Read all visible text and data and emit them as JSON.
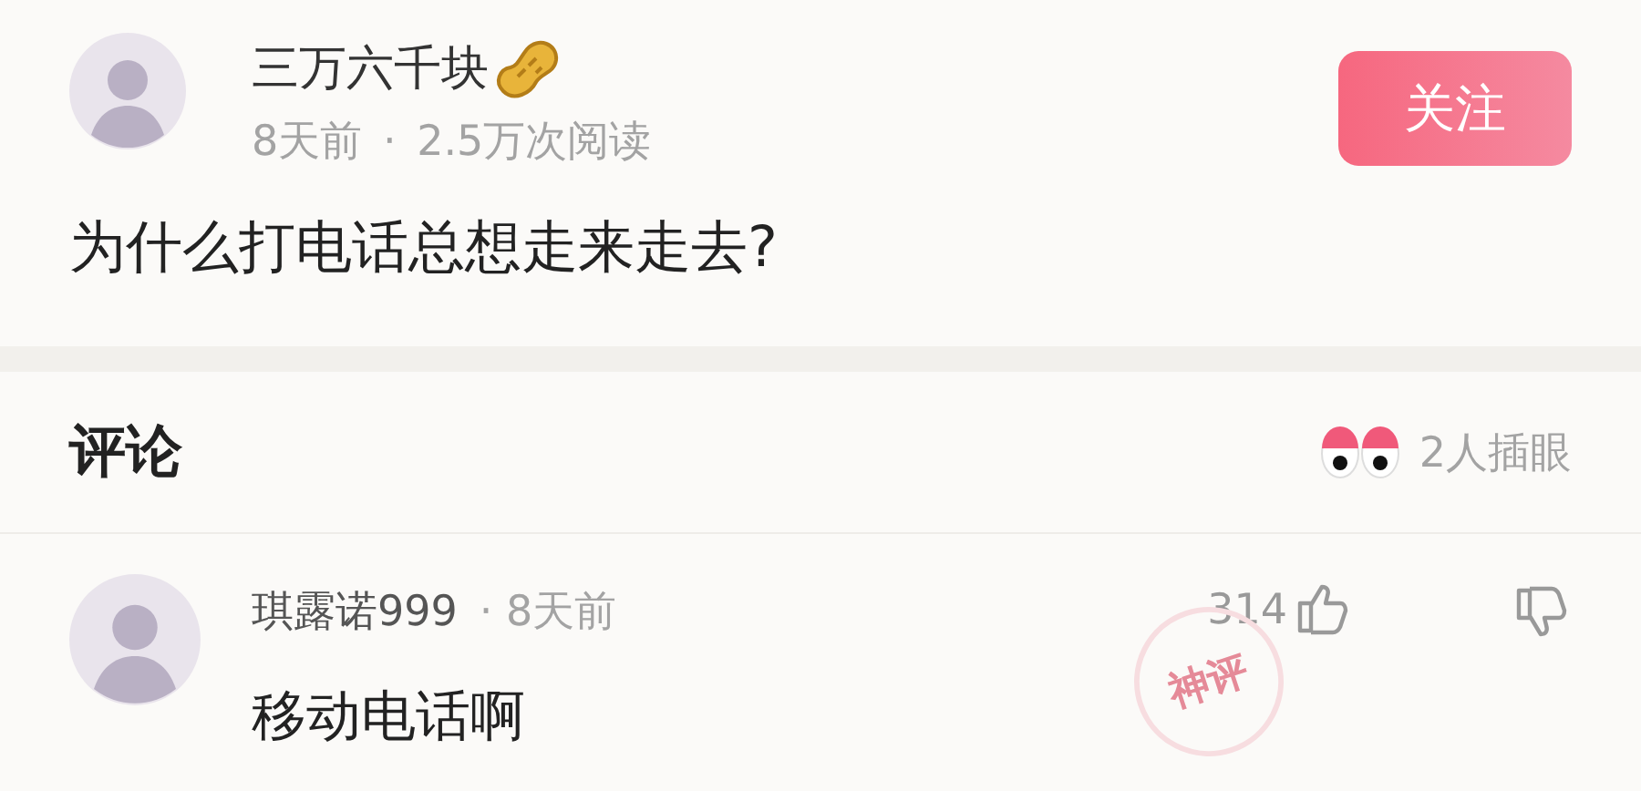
{
  "post": {
    "author": "三万六千块",
    "meta": "8天前 · 2.5万次阅读",
    "follow_button": "关注",
    "title": "为什么打电话总想走来走去?"
  },
  "comments_header": {
    "title": "评论",
    "watchers": "2人插眼"
  },
  "comments": [
    {
      "author": "琪露诺999",
      "meta": "· 8天前",
      "likes": "314",
      "text": "移动电话啊",
      "badge": "神评"
    }
  ]
}
